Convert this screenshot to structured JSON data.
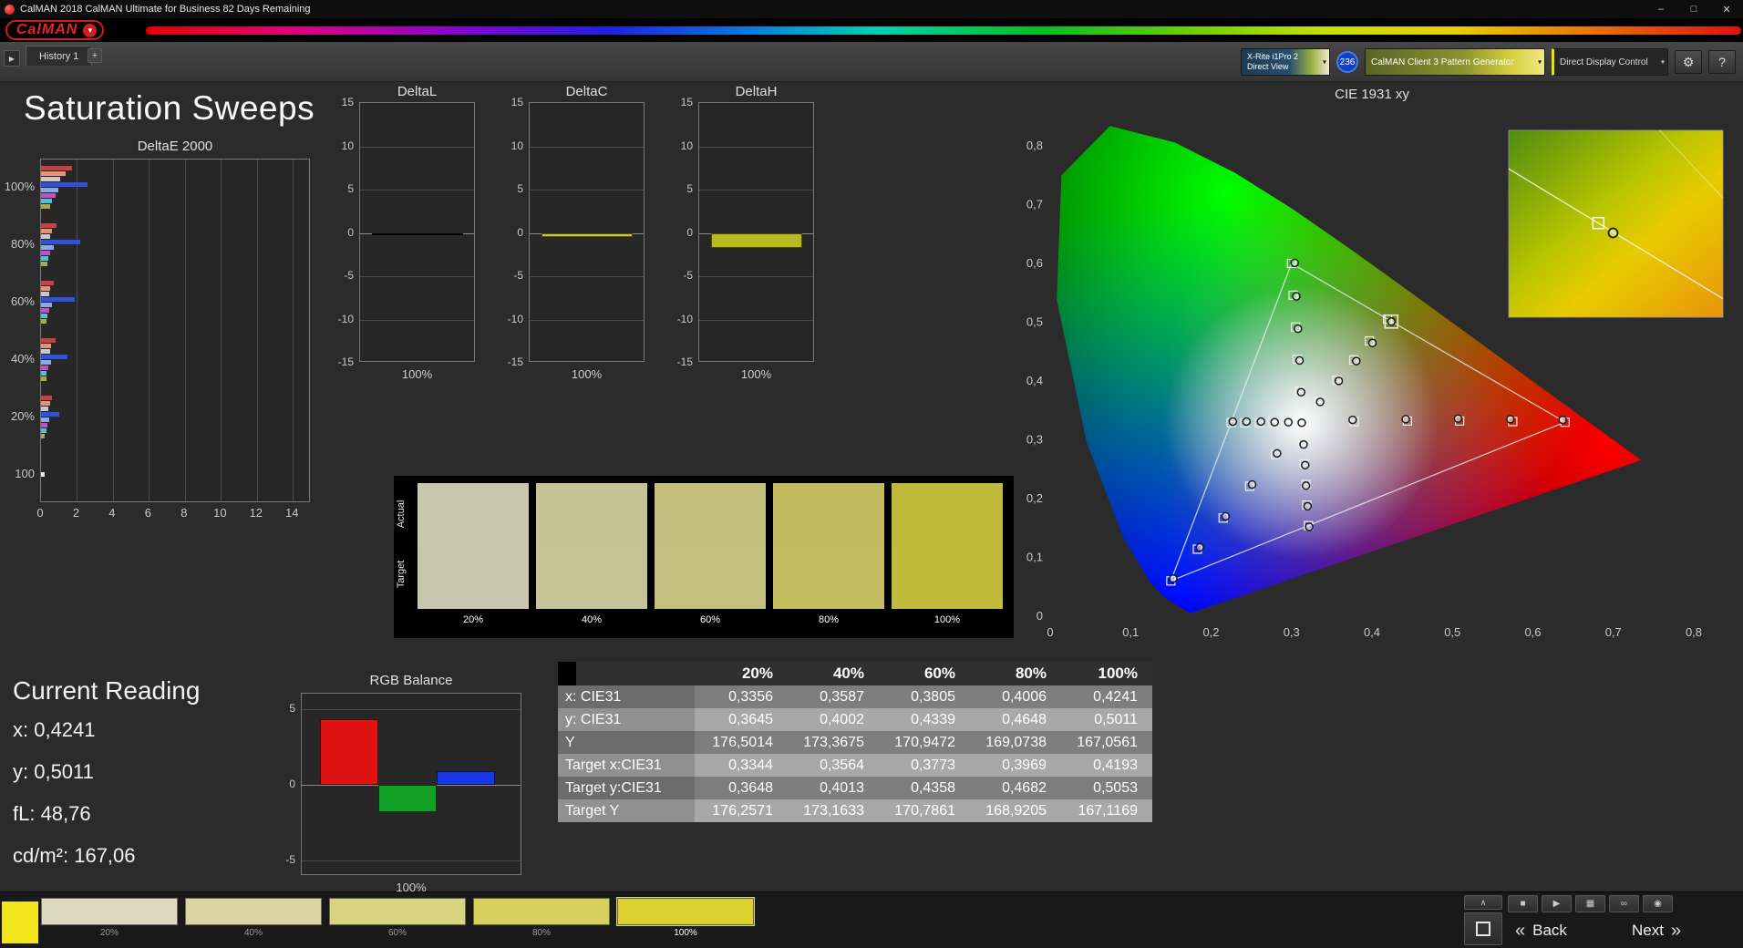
{
  "window": {
    "title": "CalMAN 2018 CalMAN Ultimate for Business 82 Days Remaining",
    "minimize": "–",
    "maximize": "□",
    "close": "✕"
  },
  "logo": {
    "text": "CalMAN",
    "dropdown": "▾"
  },
  "tabs": {
    "expand": "▶",
    "history": "History 1",
    "add": "+"
  },
  "devices": {
    "meter_line1": "X-Rite i1Pro 2",
    "meter_line2": "Direct View",
    "badge": "236",
    "pattern": "CalMAN Client 3 Pattern Generator",
    "display": "Direct Display Control",
    "gear": "⚙",
    "help": "?",
    "chevron": "▾"
  },
  "page": {
    "title": "Saturation Sweeps"
  },
  "current_reading": {
    "title": "Current Reading",
    "x": "x: 0,4241",
    "y": "y: 0,5011",
    "fl": "fL: 48,76",
    "cdm2": "cd/m²: 167,06"
  },
  "chart_data": [
    {
      "id": "deltae",
      "type": "bar",
      "title": "DeltaE 2000",
      "x_ticks": [
        "0",
        "2",
        "4",
        "6",
        "8",
        "10",
        "12",
        "14"
      ],
      "xlim": [
        0,
        15
      ],
      "group_labels": [
        "100%",
        "80%",
        "60%",
        "40%",
        "20%",
        "100"
      ],
      "bar_colors": [
        "#c84040",
        "#e09578",
        "#c9c9c9",
        "#2e52d8",
        "#88aae8",
        "#c44fc4",
        "#4cc2d8",
        "#a8a84c"
      ],
      "groups": [
        [
          1.7,
          1.35,
          1.05,
          2.6,
          0.95,
          0.8,
          0.6,
          0.5
        ],
        [
          0.85,
          0.6,
          0.5,
          2.2,
          0.7,
          0.5,
          0.4,
          0.35
        ],
        [
          0.7,
          0.5,
          0.45,
          1.9,
          0.6,
          0.45,
          0.35,
          0.3
        ],
        [
          0.8,
          0.55,
          0.5,
          1.45,
          0.55,
          0.4,
          0.3,
          0.3
        ],
        [
          0.6,
          0.5,
          0.4,
          1.0,
          0.45,
          0.35,
          0.3,
          0.2
        ],
        [
          0.2
        ]
      ],
      "last_group_color": "#e6e6e6"
    },
    {
      "id": "deltaL",
      "type": "bar",
      "title": "DeltaL",
      "ylim": [
        -15,
        15
      ],
      "y_ticks": [
        "15",
        "10",
        "5",
        "0",
        "-5",
        "-10",
        "-15"
      ],
      "value": -0.15,
      "color": "#0d0d0d",
      "x_label": "100%"
    },
    {
      "id": "deltaC",
      "type": "bar",
      "title": "DeltaC",
      "ylim": [
        -15,
        15
      ],
      "y_ticks": [
        "15",
        "10",
        "5",
        "0",
        "-5",
        "-10",
        "-15"
      ],
      "value": -0.45,
      "color": "#c9c92e",
      "x_label": "100%"
    },
    {
      "id": "deltaH",
      "type": "bar",
      "title": "DeltaH",
      "ylim": [
        -15,
        15
      ],
      "y_ticks": [
        "15",
        "10",
        "5",
        "0",
        "-5",
        "-10",
        "-15"
      ],
      "value": -1.7,
      "color": "#b9b920",
      "x_label": "100%"
    },
    {
      "id": "cie",
      "type": "scatter",
      "title": "CIE 1931 xy",
      "xlim": [
        0,
        0.8
      ],
      "ylim": [
        0,
        0.8
      ],
      "x_ticks": [
        "0",
        "0,1",
        "0,2",
        "0,3",
        "0,4",
        "0,5",
        "0,6",
        "0,7",
        "0,8"
      ],
      "y_ticks": [
        "0",
        "0,1",
        "0,2",
        "0,3",
        "0,4",
        "0,5",
        "0,6",
        "0,7",
        "0,8"
      ],
      "gamut_triangle": [
        [
          0.64,
          0.33
        ],
        [
          0.3,
          0.6
        ],
        [
          0.15,
          0.06
        ]
      ],
      "white_point": [
        0.3127,
        0.329
      ],
      "sweeps": [
        {
          "name": "yellow",
          "targets": [
            [
              0.3344,
              0.3648
            ],
            [
              0.3564,
              0.4013
            ],
            [
              0.3773,
              0.4358
            ],
            [
              0.3969,
              0.4682
            ],
            [
              0.4193,
              0.5053
            ]
          ],
          "measured": [
            [
              0.3356,
              0.3645
            ],
            [
              0.3587,
              0.4002
            ],
            [
              0.3805,
              0.4339
            ],
            [
              0.4006,
              0.4648
            ],
            [
              0.4241,
              0.5011
            ]
          ]
        },
        {
          "name": "red",
          "targets": [
            [
              0.378,
              0.331
            ],
            [
              0.444,
              0.332
            ],
            [
              0.509,
              0.332
            ],
            [
              0.575,
              0.331
            ],
            [
              0.64,
              0.33
            ]
          ],
          "measured": [
            [
              0.376,
              0.334
            ],
            [
              0.442,
              0.335
            ],
            [
              0.507,
              0.336
            ],
            [
              0.572,
              0.335
            ],
            [
              0.637,
              0.334
            ]
          ]
        },
        {
          "name": "green",
          "targets": [
            [
              0.31,
              0.383
            ],
            [
              0.307,
              0.437
            ],
            [
              0.305,
              0.492
            ],
            [
              0.302,
              0.546
            ],
            [
              0.3,
              0.6
            ]
          ],
          "measured": [
            [
              0.312,
              0.381
            ],
            [
              0.31,
              0.435
            ],
            [
              0.308,
              0.489
            ],
            [
              0.306,
              0.544
            ],
            [
              0.304,
              0.601
            ]
          ]
        },
        {
          "name": "blue",
          "targets": [
            [
              0.28,
              0.275
            ],
            [
              0.248,
              0.221
            ],
            [
              0.215,
              0.167
            ],
            [
              0.183,
              0.114
            ],
            [
              0.15,
              0.06
            ]
          ],
          "measured": [
            [
              0.282,
              0.277
            ],
            [
              0.251,
              0.224
            ],
            [
              0.218,
              0.17
            ],
            [
              0.186,
              0.117
            ],
            [
              0.153,
              0.064
            ]
          ]
        },
        {
          "name": "cyan",
          "targets": [
            [
              0.295,
              0.329
            ],
            [
              0.277,
              0.329
            ],
            [
              0.26,
              0.329
            ],
            [
              0.242,
              0.329
            ],
            [
              0.225,
              0.329
            ]
          ],
          "measured": [
            [
              0.296,
              0.33
            ],
            [
              0.279,
              0.33
            ],
            [
              0.262,
              0.331
            ],
            [
              0.244,
              0.331
            ],
            [
              0.227,
              0.331
            ]
          ]
        },
        {
          "name": "magenta",
          "targets": [
            [
              0.314,
              0.294
            ],
            [
              0.316,
              0.259
            ],
            [
              0.318,
              0.224
            ],
            [
              0.319,
              0.189
            ],
            [
              0.321,
              0.154
            ]
          ],
          "measured": [
            [
              0.315,
              0.292
            ],
            [
              0.317,
              0.257
            ],
            [
              0.318,
              0.222
            ],
            [
              0.32,
              0.187
            ],
            [
              0.322,
              0.152
            ]
          ]
        }
      ],
      "current_point": [
        0.4241,
        0.5011
      ],
      "inset": {
        "x_range": [
          0.39,
          0.46
        ],
        "y_range": [
          0.465,
          0.545
        ]
      }
    },
    {
      "id": "rgb",
      "type": "bar",
      "title": "RGB Balance",
      "ylim": [
        -6,
        6
      ],
      "y_ticks": [
        "5",
        "0",
        "-5"
      ],
      "y_tick_values": [
        5,
        0,
        -5
      ],
      "bars": [
        {
          "name": "red",
          "value": 4.3,
          "color": "#e01212"
        },
        {
          "name": "green",
          "value": -1.8,
          "color": "#12a026"
        },
        {
          "name": "blue",
          "value": 0.9,
          "color": "#1638e6"
        }
      ],
      "x_label": "100%"
    }
  ],
  "swatch_panel": {
    "row_labels": [
      "Actual",
      "Target"
    ],
    "columns": [
      {
        "label": "20%",
        "actual": "#c7c6af",
        "target": "#c8c7b0"
      },
      {
        "label": "40%",
        "actual": "#c6c297",
        "target": "#c7c398"
      },
      {
        "label": "60%",
        "actual": "#c4bf7c",
        "target": "#c5c07d"
      },
      {
        "label": "80%",
        "actual": "#c2bc5f",
        "target": "#c3bd60"
      },
      {
        "label": "100%",
        "actual": "#c0b93c",
        "target": "#c1ba3d"
      }
    ]
  },
  "table": {
    "headers": [
      "20%",
      "40%",
      "60%",
      "80%",
      "100%"
    ],
    "rows": [
      {
        "label": "x: CIE31",
        "values": [
          "0,3356",
          "0,3587",
          "0,3805",
          "0,4006",
          "0,4241"
        ]
      },
      {
        "label": "y: CIE31",
        "values": [
          "0,3645",
          "0,4002",
          "0,4339",
          "0,4648",
          "0,5011"
        ]
      },
      {
        "label": "Y",
        "values": [
          "176,5014",
          "173,3675",
          "170,9472",
          "169,0738",
          "167,0561"
        ]
      },
      {
        "label": "Target x:CIE31",
        "values": [
          "0,3344",
          "0,3564",
          "0,3773",
          "0,3969",
          "0,4193"
        ]
      },
      {
        "label": "Target y:CIE31",
        "values": [
          "0,3648",
          "0,4013",
          "0,4358",
          "0,4682",
          "0,5053"
        ]
      },
      {
        "label": "Target Y",
        "values": [
          "176,2571",
          "173,1633",
          "170,7861",
          "168,9205",
          "167,1169"
        ]
      }
    ]
  },
  "bottom_bar": {
    "current_color": "#f2e71c",
    "swatches": [
      {
        "label": "20%",
        "color": "#dcdabf",
        "selected": false
      },
      {
        "label": "40%",
        "color": "#dbd6a2",
        "selected": false
      },
      {
        "label": "60%",
        "color": "#d9d280",
        "selected": false
      },
      {
        "label": "80%",
        "color": "#d7cf5e",
        "selected": false
      },
      {
        "label": "100%",
        "color": "#dbd232",
        "selected": true
      }
    ],
    "buttons": {
      "up": "∧",
      "stop": "■",
      "play": "▶",
      "pattern": "▦",
      "loop": "∞",
      "view": "◉",
      "back": "Back",
      "next": "Next",
      "back_chevron": "«",
      "next_chevron": "»"
    }
  }
}
